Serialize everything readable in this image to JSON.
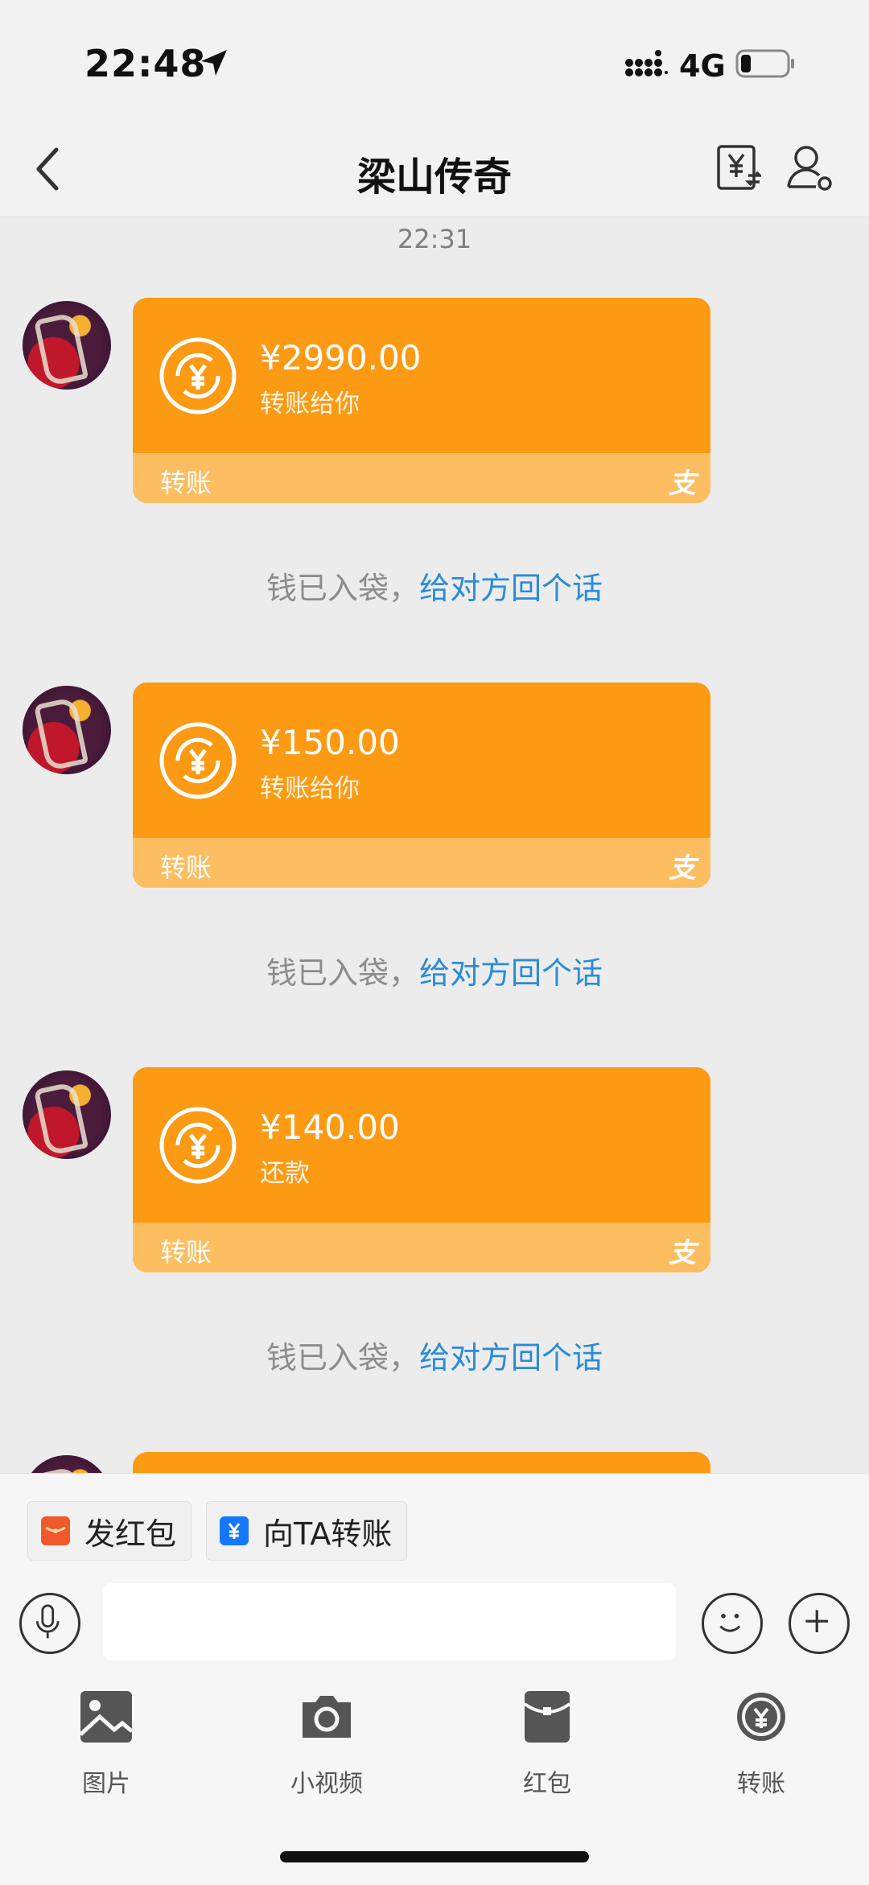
{
  "status_bar": {
    "time": "22:48",
    "network": "4G"
  },
  "nav": {
    "title": "梁山传奇"
  },
  "chat": {
    "time_divider": "22:31",
    "messages": [
      {
        "amount": "¥2990.00",
        "desc": "转账给你",
        "label": "转账",
        "alipay_mark": "支"
      },
      {
        "amount": "¥150.00",
        "desc": "转账给你",
        "label": "转账",
        "alipay_mark": "支"
      },
      {
        "amount": "¥140.00",
        "desc": "还款",
        "label": "转账",
        "alipay_mark": "支"
      }
    ],
    "received_note": {
      "prefix": "钱已入袋，",
      "link": "给对方回个话"
    }
  },
  "quick_actions": [
    {
      "label": "发红包",
      "icon": "red-envelope-icon",
      "color": "#f1582a"
    },
    {
      "label": "向TA转账",
      "icon": "yuan-transfer-icon",
      "color": "#1677ff"
    }
  ],
  "input": {
    "value": "",
    "placeholder": ""
  },
  "tools": [
    {
      "label": "图片",
      "icon": "image-icon"
    },
    {
      "label": "小视频",
      "icon": "camera-icon"
    },
    {
      "label": "红包",
      "icon": "red-envelope-icon"
    },
    {
      "label": "转账",
      "icon": "transfer-icon"
    }
  ],
  "colors": {
    "card_orange": "#fc9a14",
    "card_band": "#fdbd61",
    "link_blue": "#2a8bd7"
  }
}
